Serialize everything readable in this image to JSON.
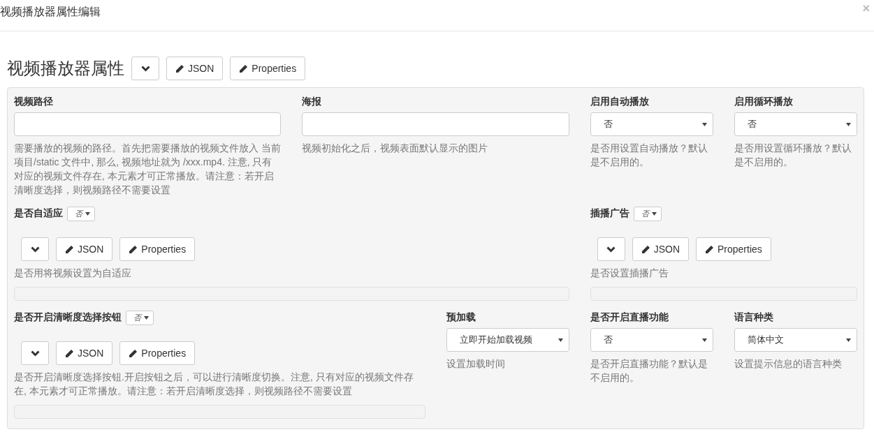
{
  "dialog": {
    "title": "视频播放器属性编辑",
    "close": "×"
  },
  "heading": {
    "title": "视频播放器属性",
    "buttons": [
      {
        "kind": "collapse"
      },
      {
        "kind": "edit",
        "label": "JSON"
      },
      {
        "kind": "edit",
        "label": "Properties"
      }
    ]
  },
  "rows": [
    [
      {
        "kind": "text",
        "label": "视频路径",
        "description": "需要播放的视频的路径。首先把需要播放的视频文件放入 当前项目/static 文件中, 那么, 视频地址就为 /xxx.mp4. 注意, 只有对应的视频文件存在, 本元素才可正常播放。请注意：若开启清晰度选择，则视频路径不需要设置"
      },
      {
        "kind": "text",
        "label": "海报",
        "description": "视频初始化之后，视频表面默认显示的图片"
      },
      {
        "kind": "select",
        "label": "启用自动播放",
        "value": "否",
        "description": "是否用设置自动播放？默认是不启用的。"
      },
      {
        "kind": "select",
        "label": "启用循环播放",
        "value": "否",
        "description": "是否用设置循环播放？默认是不启用的。"
      }
    ],
    [
      {
        "kind": "object",
        "label": "是否自适应",
        "value": "否",
        "buttons": [
          {
            "kind": "collapse"
          },
          {
            "kind": "edit",
            "label": "JSON"
          },
          {
            "kind": "edit",
            "label": "Properties"
          }
        ],
        "description": "是否用将视频设置为自适应"
      },
      {
        "kind": "object",
        "label": "插播广告",
        "value": "否",
        "buttons": [
          {
            "kind": "collapse"
          },
          {
            "kind": "edit",
            "label": "JSON"
          },
          {
            "kind": "edit",
            "label": "Properties"
          }
        ],
        "description": "是否设置插播广告"
      }
    ],
    [
      {
        "kind": "object",
        "label": "是否开启清晰度选择按钮",
        "value": "否",
        "buttons": [
          {
            "kind": "collapse"
          },
          {
            "kind": "edit",
            "label": "JSON"
          },
          {
            "kind": "edit",
            "label": "Properties"
          }
        ],
        "description": "是否开启清晰度选择按钮.开启按钮之后，可以进行清晰度切换。注意, 只有对应的视频文件存在, 本元素才可正常播放。请注意：若开启清晰度选择，则视频路径不需要设置"
      },
      {
        "kind": "select",
        "label": "预加载",
        "value": "立即开始加载视频",
        "description": "设置加载时间"
      },
      {
        "kind": "select",
        "label": "是否开启直播功能",
        "value": "否",
        "description": "是否开启直播功能？默认是不启用的。"
      },
      {
        "kind": "select",
        "label": "语言种类",
        "value": "简体中文",
        "description": "设置提示信息的语言种类"
      }
    ]
  ]
}
